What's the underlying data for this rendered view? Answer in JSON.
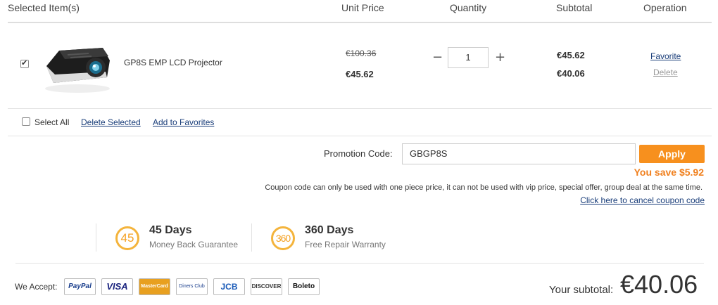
{
  "header": {
    "selected_items": "Selected Item(s)",
    "unit_price": "Unit Price",
    "quantity": "Quantity",
    "subtotal": "Subtotal",
    "operation": "Operation"
  },
  "item": {
    "name": "GP8S EMP LCD Projector",
    "checked": true,
    "original_price": "€100.36",
    "unit_price": "€45.62",
    "quantity": "1",
    "minus_label": "−",
    "plus_label": "+",
    "subtotal_before": "€45.62",
    "subtotal_after": "€40.06",
    "favorite_label": "Favorite",
    "delete_label": "Delete"
  },
  "bulk_actions": {
    "select_all": "Select All",
    "delete_selected": "Delete Selected",
    "add_to_favorites": "Add to Favorites"
  },
  "promotion": {
    "label": "Promotion Code:",
    "code": "GBGP8S",
    "apply_label": "Apply",
    "savings": "You save $5.92",
    "note": "Coupon code can only be used with one piece price, it can not be used with vip price, special offer, group deal at the same time.",
    "cancel_link": "Click here to cancel coupon code"
  },
  "guarantees": [
    {
      "badge": "45",
      "title": "45 Days",
      "subtitle": "Money Back Guarantee"
    },
    {
      "badge": "360",
      "title": "360 Days",
      "subtitle": "Free Repair Warranty"
    }
  ],
  "payment": {
    "label": "We Accept:",
    "methods": [
      "PayPal",
      "VISA",
      "MasterCard",
      "Diners Club",
      "JCB",
      "DISCOVER",
      "Boleto"
    ]
  },
  "totals": {
    "label": "Your subtotal:",
    "value": "€40.06"
  },
  "colors": {
    "accent": "#f7901e",
    "link": "#1a3e7a",
    "badge": "#f4b43c"
  }
}
